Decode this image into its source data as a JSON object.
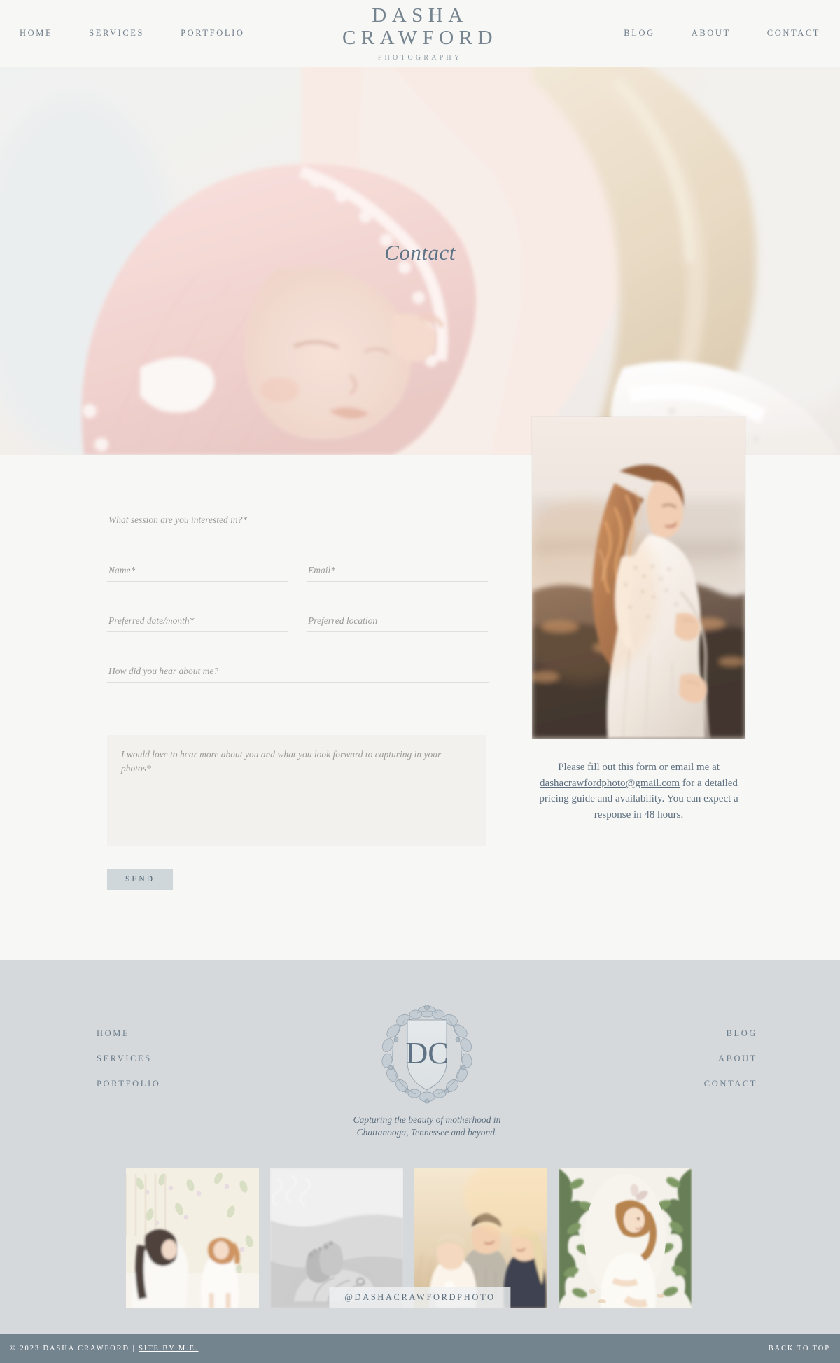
{
  "header": {
    "nav_left": [
      {
        "label": "HOME"
      },
      {
        "label": "SERVICES"
      },
      {
        "label": "PORTFOLIO"
      }
    ],
    "nav_right": [
      {
        "label": "BLOG"
      },
      {
        "label": "ABOUT"
      },
      {
        "label": "CONTACT"
      }
    ],
    "logo": {
      "line1": "DASHA",
      "line2": "CRAWFORD",
      "subtitle": "PHOTOGRAPHY"
    }
  },
  "hero": {
    "title": "Contact",
    "image_alt": "newborn-in-pink-knit-bonnet-held-by-mother"
  },
  "form": {
    "session_placeholder": "What session are you interested in?*",
    "name_placeholder": "Name*",
    "email_placeholder": "Email*",
    "date_placeholder": "Preferred date/month*",
    "location_placeholder": "Preferred location",
    "referral_placeholder": "How did you hear about me?",
    "message_placeholder": "I would love to hear more about you and what you look forward to capturing in your photos*",
    "send_label": "SEND"
  },
  "aside": {
    "image_alt": "maternity-portrait-at-sunset-by-the-ocean",
    "text_before": "Please fill out this form or email me at ",
    "email": "dashacrawfordphoto@gmail.com",
    "text_after": " for a detailed pricing guide and availability. You can expect a response in 48 hours."
  },
  "footer": {
    "nav_left": [
      {
        "label": "HOME"
      },
      {
        "label": "SERVICES"
      },
      {
        "label": "PORTFOLIO"
      }
    ],
    "nav_right": [
      {
        "label": "BLOG"
      },
      {
        "label": "ABOUT"
      },
      {
        "label": "CONTACT"
      }
    ],
    "crest": {
      "monogram": "DC",
      "alt": "floral-crest-monogram"
    },
    "tagline": "Capturing the beauty of motherhood in\nChattanooga, Tennessee and beyond.",
    "instagram_handle": "@DASHACRAWFORDPHOTO",
    "gallery": [
      {
        "alt": "mother-and-toddler-girl-in-white-dresses-indoors"
      },
      {
        "alt": "black-and-white-newborn-feet-cradled-in-hands"
      },
      {
        "alt": "family-with-baby-outdoors-at-golden-hour"
      },
      {
        "alt": "toddler-girl-with-bow-sitting-among-greenery"
      }
    ]
  },
  "bottombar": {
    "copyright": "© 2023 DASHA CRAWFORD | ",
    "credit": "SITE BY M.E.",
    "back_to_top": "BACK TO TOP"
  },
  "colors": {
    "page_bg": "#f7f7f6",
    "footer_bg": "#d5d9dc",
    "bottombar_bg": "#74848f",
    "accent_slate": "#5d6f7e",
    "nav_slate": "#707e8b",
    "button_bg": "#cfd7db",
    "textarea_bg": "#f2f1ed"
  }
}
